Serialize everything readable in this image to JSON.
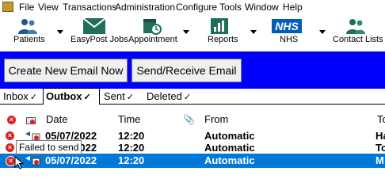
{
  "menu": {
    "file": "File",
    "view": "View",
    "transactions": "Transactions",
    "administration": "Administration",
    "configure": "Configure",
    "tools": "Tools",
    "window": "Window",
    "help": "Help"
  },
  "toolbar": {
    "patients": "Patients",
    "easypost": "EasyPost Jobs",
    "appointment": "Appointment",
    "reports": "Reports",
    "nhs": "NHS",
    "nhs_logo": "NHS",
    "contact_lists": "Contact Lists"
  },
  "actions": {
    "create_email": "Create New Email Now",
    "send_receive": "Send/Receive Email"
  },
  "tabs": [
    {
      "label": "Inbox",
      "check": "✓"
    },
    {
      "label": "Outbox",
      "check": "✓"
    },
    {
      "label": "Sent",
      "check": "✓"
    },
    {
      "label": "Deleted",
      "check": "✓"
    }
  ],
  "columns": {
    "date": "Date",
    "time": "Time",
    "from": "From",
    "to": "To"
  },
  "rows": [
    {
      "date": "05/07/2022",
      "time": "12:20",
      "from": "Automatic",
      "to": "Ha"
    },
    {
      "date": "05/07/2022",
      "time": "12:20",
      "from": "Automatic",
      "to": "Tc"
    },
    {
      "date": "05/07/2022",
      "time": "12:20",
      "from": "Automatic",
      "to": "M"
    }
  ],
  "tooltip": "Failed to send",
  "colors": {
    "panel_blue": "#0000ff",
    "selection_blue": "#0078d7",
    "error_red": "#e02020"
  }
}
